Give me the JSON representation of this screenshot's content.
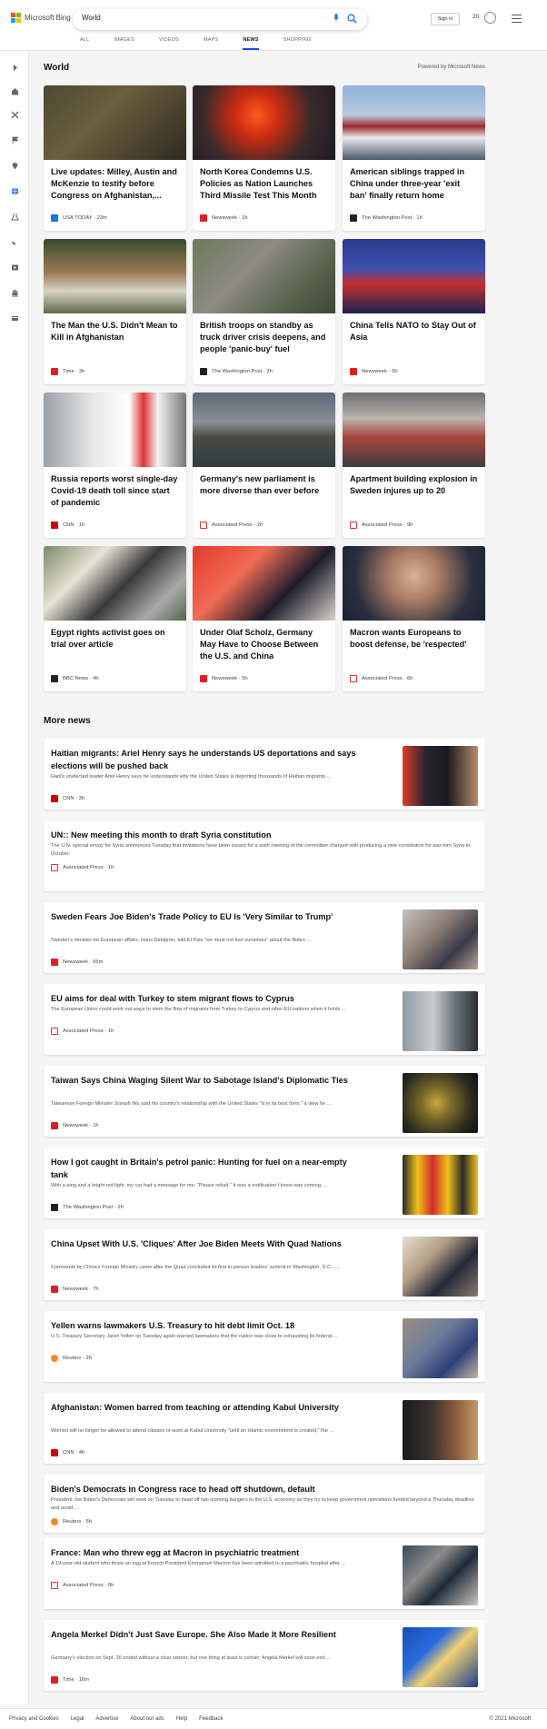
{
  "header": {
    "brand": "Microsoft Bing",
    "query": "World",
    "tabs": [
      {
        "label": "ALL",
        "active": false
      },
      {
        "label": "IMAGES",
        "active": false
      },
      {
        "label": "VIDEOS",
        "active": false
      },
      {
        "label": "MAPS",
        "active": false
      },
      {
        "label": "NEWS",
        "active": true
      },
      {
        "label": "SHOPPING",
        "active": false
      }
    ],
    "sign_in": "Sign in",
    "rewards_count": "20"
  },
  "rail": [
    "expand-icon",
    "home-icon",
    "sports-icon",
    "flag-icon",
    "location-icon",
    "globe-icon",
    "science-icon",
    "rocket-icon",
    "entertainment-icon",
    "bank-icon",
    "card-icon"
  ],
  "world": {
    "heading": "World",
    "powered": "Powered by Microsoft News",
    "cards": [
      {
        "title": "Live updates: Milley, Austin and McKenzie to testify before Congress on Afghanistan,...",
        "source": "USA TODAY",
        "time": "23m",
        "fav_color": "#1a73e8"
      },
      {
        "title": "North Korea Condemns U.S. Policies as Nation Launches Third Missile Test This Month",
        "source": "Newsweek",
        "time": "1h",
        "fav_color": "#e02020"
      },
      {
        "title": "American siblings trapped in China under three-year 'exit ban' finally return home",
        "source": "The Washington Post",
        "time": "1h",
        "fav_color": "#222222"
      },
      {
        "title": "The Man the U.S. Didn't Mean to Kill in Afghanistan",
        "source": "Time",
        "time": "3h",
        "fav_color": "#e02020"
      },
      {
        "title": "British troops on standby as truck driver crisis deepens, and people 'panic-buy' fuel",
        "source": "The Washington Post",
        "time": "2h",
        "fav_color": "#222222"
      },
      {
        "title": "China Tells NATO to Stay Out of Asia",
        "source": "Newsweek",
        "time": "5h",
        "fav_color": "#e02020"
      },
      {
        "title": "Russia reports worst single-day Covid-19 death toll since start of pandemic",
        "source": "CNN",
        "time": "1h",
        "fav_color": "#cc0000"
      },
      {
        "title": "Germany's new parliament is more diverse than ever before",
        "source": "Associated Press",
        "time": "2h",
        "fav_color": "#ffffff"
      },
      {
        "title": "Apartment building explosion in Sweden injures up to 20",
        "source": "Associated Press",
        "time": "9h",
        "fav_color": "#ffffff"
      },
      {
        "title": "Egypt rights activist goes on trial over article",
        "source": "BBC News",
        "time": "4h",
        "fav_color": "#222222"
      },
      {
        "title": "Under Olaf Scholz, Germany May Have to Choose Between the U.S. and China",
        "source": "Newsweek",
        "time": "5h",
        "fav_color": "#e02020"
      },
      {
        "title": "Macron wants Europeans to boost defense, be 'respected'",
        "source": "Associated Press",
        "time": "6h",
        "fav_color": "#ffffff"
      }
    ]
  },
  "more": {
    "heading": "More news",
    "items": [
      {
        "title": "Haitian migrants: Ariel Henry says he understands US deportations and says elections will be pushed back",
        "snippet": "Haiti's unelected leader Ariel Henry says he understands why the United States is deporting thousands of Haitian migrants ...",
        "source": "CNN",
        "time": "3h",
        "has_image": true
      },
      {
        "title": "UN:: New meeting this month to draft Syria constitution",
        "snippet": "The U.N. special envoy for Syria announced Tuesday that invitations have been issued for a sixth meeting of the committee charged with producing a new constitution for war-torn Syria in October.",
        "source": "Associated Press",
        "time": "1h",
        "has_image": false
      },
      {
        "title": "Sweden Fears Joe Biden's Trade Policy to EU Is 'Very Similar to Trump'",
        "snippet": "Sweden's minister for European affairs, Hans Dahlgren, told El Pais \"we must not fool ourselves\" about the Biden ...",
        "source": "Newsweek",
        "time": "55m",
        "has_image": true
      },
      {
        "title": "EU aims for deal with Turkey to stem migrant flows to Cyprus",
        "snippet": "The European Union could work out ways to stem the flow of migrants from Turkey to Cyprus and other EU nations when it holds ...",
        "source": "Associated Press",
        "time": "1h",
        "has_image": true
      },
      {
        "title": "Taiwan Says China Waging Silent War to Sabotage Island's Diplomatic Ties",
        "snippet": "Taiwanese Foreign Minister Joseph Wu said his country's relationship with the United States \"is in its best form,\" a view he ...",
        "source": "Newsweek",
        "time": "1h",
        "has_image": true
      },
      {
        "title": "How I got caught in Britain's petrol panic: Hunting for fuel on a near-empty tank",
        "snippet": "With a ping and a bright red light, my car had a message for me: \"Please refuel.\" It was a notification I knew was coming, ...",
        "source": "The Washington Post",
        "time": "2h",
        "has_image": true
      },
      {
        "title": "China Upset With U.S. 'Cliques' After Joe Biden Meets With Quad Nations",
        "snippet": "Comments by China's Foreign Ministry came after the Quad concluded its first in-person leaders' summit in Washington, D.C., ...",
        "source": "Newsweek",
        "time": "7h",
        "has_image": true
      },
      {
        "title": "Yellen warns lawmakers U.S. Treasury to hit debt limit Oct. 18",
        "snippet": "U.S. Treasury Secretary Janet Yellen on Tuesday again warned lawmakers that the nation was close to exhausting its federal ...",
        "source": "Reuters",
        "time": "2h",
        "has_image": true
      },
      {
        "title": "Afghanistan: Women barred from teaching or attending Kabul University",
        "snippet": "Women will no longer be allowed to attend classes or work at Kabul University \"until an Islamic environment is created,\" the ...",
        "source": "CNN",
        "time": "4h",
        "has_image": true
      },
      {
        "title": "Biden's Democrats in Congress race to head off shutdown, default",
        "snippet": "President Joe Biden's Democrats will seek on Tuesday to head off two looming dangers to the U.S. economy as they try to keep government operations funded beyond a Thursday deadline and avoid ...",
        "source": "Reuters",
        "time": "5h",
        "has_image": false
      },
      {
        "title": "France: Man who threw egg at Macron in psychiatric treatment",
        "snippet": "A 19-year-old student who threw an egg at French President Emmanuel Macron has been admitted to a psychiatric hospital after ...",
        "source": "Associated Press",
        "time": "6h",
        "has_image": true
      },
      {
        "title": "Angela Merkel Didn't Just Save Europe. She Also Made It More Resilient",
        "snippet": "Germany's election on Sept. 26 ended without a clear winner, but one thing at least is certain: Angela Merkel will soon exit ...",
        "source": "Time",
        "time": "16m",
        "has_image": true
      }
    ]
  },
  "footer": {
    "links": [
      "Privacy and Cookies",
      "Legal",
      "Advertise",
      "About our ads",
      "Help",
      "Feedback"
    ],
    "copyright": "© 2021 Microsoft"
  }
}
